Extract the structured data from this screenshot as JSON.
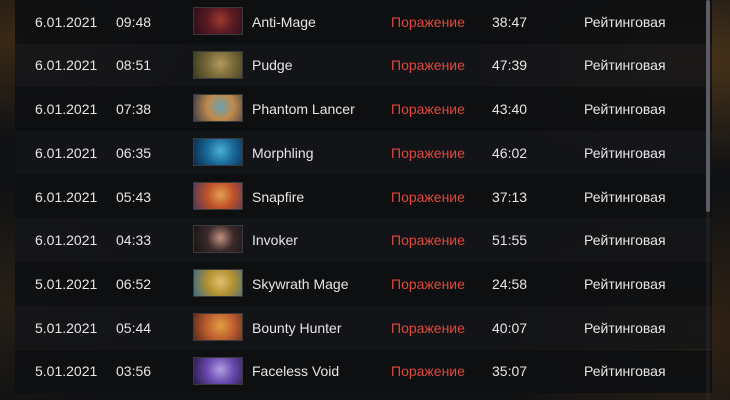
{
  "result_color": "#e0483b",
  "matches": [
    {
      "date": "6.01.2021",
      "time": "09:48",
      "hero": "Anti-Mage",
      "result": "Поражение",
      "duration": "38:47",
      "mode": "Рейтинговая",
      "icon": "anti-mage-portrait",
      "colors": [
        "#5a1a24",
        "#a03a2a",
        "#2a0f18"
      ]
    },
    {
      "date": "6.01.2021",
      "time": "08:51",
      "hero": "Pudge",
      "result": "Поражение",
      "duration": "47:39",
      "mode": "Рейтинговая",
      "icon": "pudge-portrait",
      "colors": [
        "#7a6a3a",
        "#b0985a",
        "#3a3a20"
      ]
    },
    {
      "date": "6.01.2021",
      "time": "07:38",
      "hero": "Phantom Lancer",
      "result": "Поражение",
      "duration": "43:40",
      "mode": "Рейтинговая",
      "icon": "phantom-lancer-portrait",
      "colors": [
        "#c08a4a",
        "#6aa0b0",
        "#3a3a4a"
      ]
    },
    {
      "date": "6.01.2021",
      "time": "06:35",
      "hero": "Morphling",
      "result": "Поражение",
      "duration": "46:02",
      "mode": "Рейтинговая",
      "icon": "morphling-portrait",
      "colors": [
        "#1a6a9a",
        "#4ab0d0",
        "#0a2a4a"
      ]
    },
    {
      "date": "6.01.2021",
      "time": "05:43",
      "hero": "Snapfire",
      "result": "Поражение",
      "duration": "37:13",
      "mode": "Рейтинговая",
      "icon": "snapfire-portrait",
      "colors": [
        "#c0502a",
        "#e0a050",
        "#4a3a5a"
      ]
    },
    {
      "date": "6.01.2021",
      "time": "04:33",
      "hero": "Invoker",
      "result": "Поражение",
      "duration": "51:55",
      "mode": "Рейтинговая",
      "icon": "invoker-portrait",
      "colors": [
        "#3a2a2a",
        "#c09080",
        "#1a1414"
      ]
    },
    {
      "date": "5.01.2021",
      "time": "06:52",
      "hero": "Skywrath Mage",
      "result": "Поражение",
      "duration": "24:58",
      "mode": "Рейтинговая",
      "icon": "skywrath-mage-portrait",
      "colors": [
        "#b09030",
        "#e0c070",
        "#3a6a8a"
      ]
    },
    {
      "date": "5.01.2021",
      "time": "05:44",
      "hero": "Bounty Hunter",
      "result": "Поражение",
      "duration": "40:07",
      "mode": "Рейтинговая",
      "icon": "bounty-hunter-portrait",
      "colors": [
        "#c06030",
        "#e0a040",
        "#5a2a1a"
      ]
    },
    {
      "date": "5.01.2021",
      "time": "03:56",
      "hero": "Faceless Void",
      "result": "Поражение",
      "duration": "35:07",
      "mode": "Рейтинговая",
      "icon": "faceless-void-portrait",
      "colors": [
        "#6a4ab0",
        "#b0a0e0",
        "#2a1a4a"
      ]
    }
  ]
}
